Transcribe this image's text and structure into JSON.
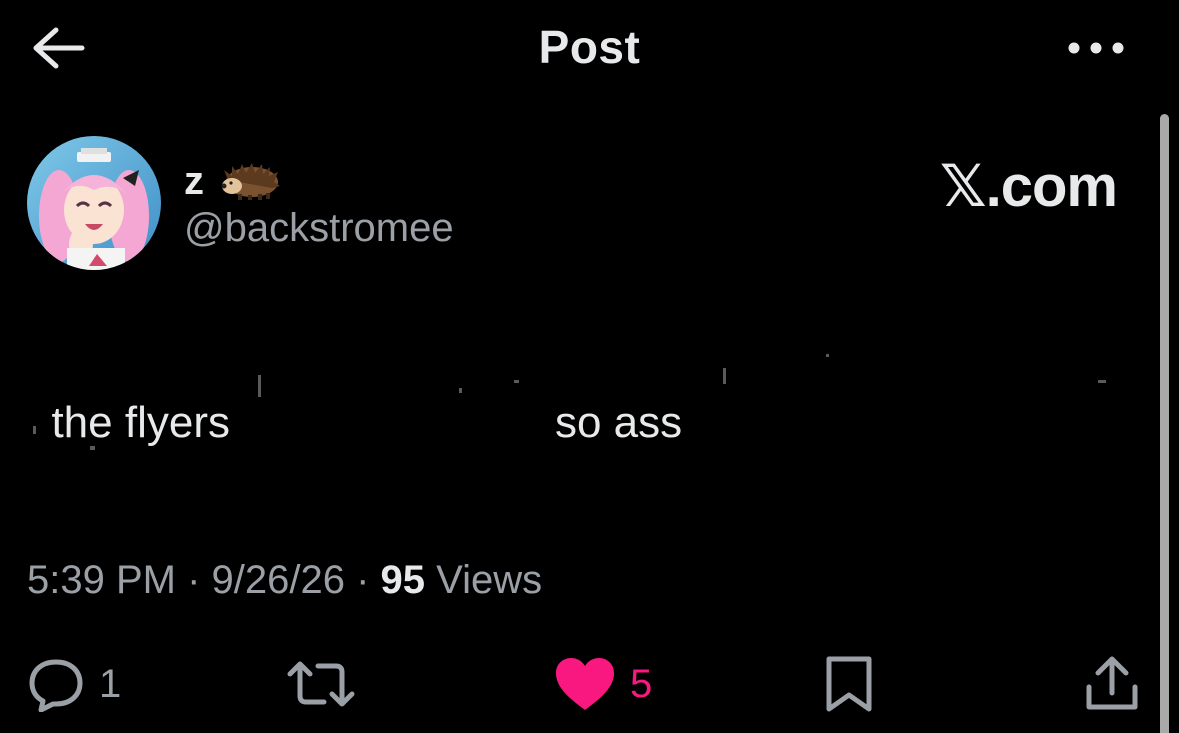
{
  "header": {
    "title": "Post",
    "back_icon": "arrow-left-icon",
    "more_icon": "more-horizontal-icon"
  },
  "author": {
    "display_name": "z",
    "emoji_icon": "hedgehog-icon",
    "handle": "@backstromee",
    "avatar_icon": "avatar-anime-girl"
  },
  "watermark": "𝕏.com",
  "post": {
    "text_part1": "the flyers",
    "text_part2": "so ass"
  },
  "meta": {
    "time": "5:39 PM",
    "sep1": " · ",
    "date": "9/26/26",
    "sep2": " · ",
    "views_count": "95",
    "views_label": " Views"
  },
  "actions": {
    "reply": {
      "icon": "reply-icon",
      "count": "1"
    },
    "repost": {
      "icon": "repost-icon"
    },
    "like": {
      "icon": "heart-filled-icon",
      "count": "5",
      "liked": true
    },
    "bookmark": {
      "icon": "bookmark-icon"
    },
    "share": {
      "icon": "share-icon"
    }
  },
  "colors": {
    "background": "#000000",
    "primary_text": "#e7e9ea",
    "secondary_text": "#9aa0a6",
    "like_pink": "#f91880"
  }
}
